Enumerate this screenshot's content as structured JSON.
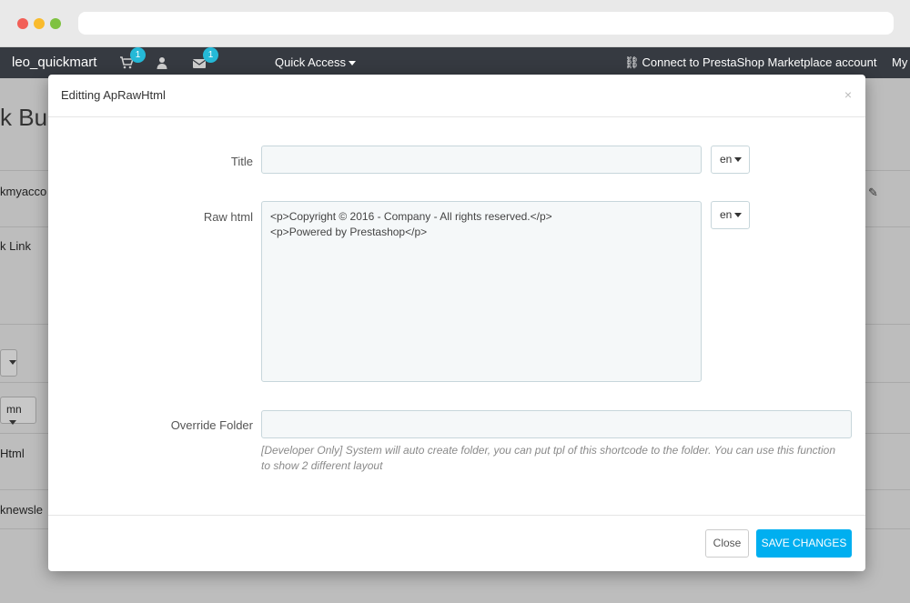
{
  "topnav": {
    "shop_name": "leo_quickmart",
    "cart_badge": "1",
    "mail_badge": "1",
    "quick_access": "Quick Access",
    "connect_link": "Connect to PrestaShop Marketplace account",
    "my_link": "My"
  },
  "background": {
    "page_title": "k Bui",
    "row1": "kmyacco",
    "row2": "k Link",
    "column_select": "mn",
    "row3": "Html",
    "row4": "knewsle"
  },
  "modal": {
    "title": "Editting ApRawHtml",
    "title_label": "Title",
    "title_value": "",
    "title_lang": "en",
    "raw_html_label": "Raw html",
    "raw_html_value": "<p>Copyright © 2016 - Company - All rights reserved.</p>\n<p>Powered by Prestashop</p>",
    "raw_html_lang": "en",
    "override_folder_label": "Override Folder",
    "override_folder_value": "",
    "override_help": "[Developer Only] System will auto create folder, you can put tpl of this shortcode to the folder. You can use this function to show 2 different layout",
    "close_button": "Close",
    "save_button": "SAVE CHANGES"
  },
  "colors": {
    "topnav_bg": "#363a41",
    "badge": "#25b9d7",
    "save_button": "#00aff0"
  }
}
